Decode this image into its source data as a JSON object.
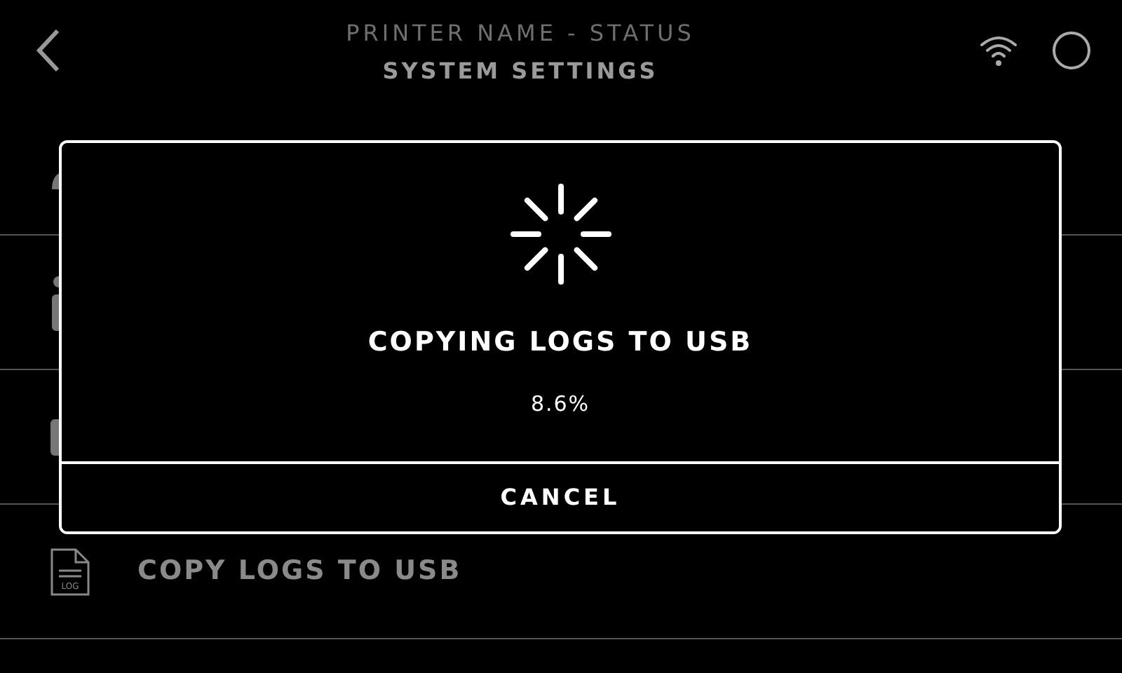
{
  "header": {
    "subtitle": "PRINTER NAME - STATUS",
    "title": "SYSTEM SETTINGS"
  },
  "rows": [
    {
      "kind": "user"
    },
    {
      "kind": "info"
    },
    {
      "kind": "usb"
    },
    {
      "kind": "log",
      "icon_text": "LOG",
      "label": "COPY LOGS TO USB"
    }
  ],
  "dialog": {
    "title": "COPYING LOGS TO USB",
    "progress": "8.6%",
    "button": "CANCEL"
  }
}
